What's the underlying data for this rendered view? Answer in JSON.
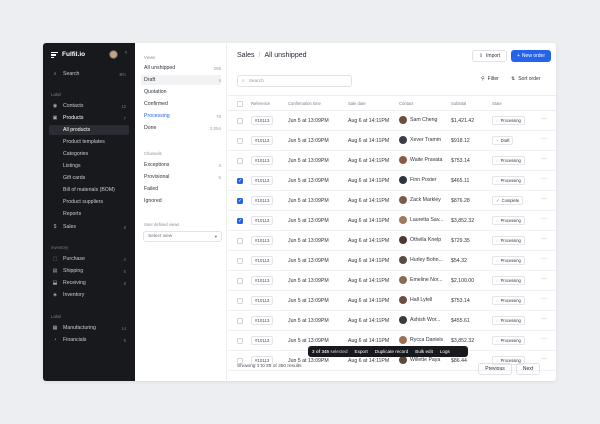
{
  "brand": {
    "name": "Fulfil.io"
  },
  "sidebar": {
    "search": {
      "label": "Search",
      "shortcut": "⌘K"
    },
    "label_section": "Label",
    "main_items": [
      {
        "label": "Contacts",
        "icon": "contacts-icon",
        "count": "12"
      },
      {
        "label": "Products",
        "icon": "products-icon",
        "count": "7"
      }
    ],
    "product_sub": [
      "All products",
      "Product templates",
      "Categories",
      "Listings",
      "Gift cards",
      "Bill of materials (BOM)",
      "Product suppliers",
      "Reports"
    ],
    "sales": {
      "label": "Sales",
      "count": "8"
    },
    "inventory_section": "Inventory",
    "inventory_items": [
      {
        "label": "Purchase",
        "count": "4"
      },
      {
        "label": "Shipping",
        "count": "5"
      },
      {
        "label": "Receiving",
        "count": "8"
      },
      {
        "label": "Inventory",
        "count": ""
      }
    ],
    "label_section2": "Label",
    "bottom_items": [
      {
        "label": "Manufacturing",
        "count": "14"
      },
      {
        "label": "Financials",
        "count": "5"
      }
    ]
  },
  "views": {
    "views_title": "Views",
    "items": [
      {
        "label": "All unshipped",
        "count": "258"
      },
      {
        "label": "Draft",
        "count": "4"
      },
      {
        "label": "Quotation",
        "count": ""
      },
      {
        "label": "Confirmed",
        "count": ""
      },
      {
        "label": "Processing",
        "count": "78"
      },
      {
        "label": "Done",
        "count": "2,054"
      }
    ],
    "channels_title": "Channels",
    "channels": [
      {
        "label": "Exceptions",
        "count": "3"
      },
      {
        "label": "Provisional",
        "count": "5"
      },
      {
        "label": "Failed",
        "count": ""
      },
      {
        "label": "Ignored",
        "count": ""
      }
    ],
    "user_defined_title": "User defined views",
    "select_view": "Select view"
  },
  "main": {
    "breadcrumb_root": "Sales",
    "breadcrumb_current": "All unshipped",
    "import_label": "Import",
    "new_order_label": "New order",
    "search_placeholder": "Search",
    "filter_label": "Filter",
    "sort_label": "Sort order",
    "columns": [
      "Reference",
      "Confirmation time",
      "Sale date",
      "Contact",
      "Subtotal",
      "State"
    ],
    "rows": [
      {
        "ref": "#10113",
        "conf": "Jun 5 at 13:09PM",
        "date": "Aug 6 at 14:11PM",
        "contact": "Sam Cheng",
        "sub": "$1,421.42",
        "state": "Processing",
        "checked": false,
        "color": "#6b4f3a"
      },
      {
        "ref": "#10113",
        "conf": "Jun 5 at 13:09PM",
        "date": "Aug 6 at 14:11PM",
        "contact": "Xever Tramm",
        "sub": "$918.12",
        "state": "Draft",
        "checked": false,
        "color": "#3a3f47"
      },
      {
        "ref": "#10113",
        "conf": "Jun 5 at 13:09PM",
        "date": "Aug 6 at 14:11PM",
        "contact": "Waite Pravata",
        "sub": "$753.14",
        "state": "Processing",
        "checked": false,
        "color": "#8a5a44"
      },
      {
        "ref": "#10113",
        "conf": "Jun 5 at 13:09PM",
        "date": "Aug 6 at 14:11PM",
        "contact": "Finn Poster",
        "sub": "$465.11",
        "state": "Processing",
        "checked": true,
        "color": "#2f3540"
      },
      {
        "ref": "#10113",
        "conf": "Jun 5 at 13:09PM",
        "date": "Aug 6 at 14:11PM",
        "contact": "Zack Markley",
        "sub": "$876.28",
        "state": "Complete",
        "checked": true,
        "color": "#7a5c48"
      },
      {
        "ref": "#10113",
        "conf": "Jun 5 at 13:09PM",
        "date": "Aug 6 at 14:11PM",
        "contact": "Lauretta Sav...",
        "sub": "$3,852.32",
        "state": "Processing",
        "checked": true,
        "color": "#a0785c"
      },
      {
        "ref": "#10113",
        "conf": "Jun 5 at 13:09PM",
        "date": "Aug 6 at 14:11PM",
        "contact": "Othella Knelp",
        "sub": "$729.35",
        "state": "Processing",
        "checked": false,
        "color": "#4a3a33"
      },
      {
        "ref": "#10113",
        "conf": "Jun 5 at 13:09PM",
        "date": "Aug 6 at 14:11PM",
        "contact": "Hurley Bohn...",
        "sub": "$54.32",
        "state": "Processing",
        "checked": false,
        "color": "#5a4a40"
      },
      {
        "ref": "#10113",
        "conf": "Jun 5 at 13:09PM",
        "date": "Aug 6 at 14:11PM",
        "contact": "Emeline Nor...",
        "sub": "$2,100.00",
        "state": "Processing",
        "checked": false,
        "color": "#8a6a55"
      },
      {
        "ref": "#10113",
        "conf": "Jun 5 at 13:09PM",
        "date": "Aug 6 at 14:11PM",
        "contact": "Hall Lytell",
        "sub": "$753.14",
        "state": "Processing",
        "checked": false,
        "color": "#6e4e3e"
      },
      {
        "ref": "#10113",
        "conf": "Jun 5 at 13:09PM",
        "date": "Aug 6 at 14:11PM",
        "contact": "Ashish Wor...",
        "sub": "$455.61",
        "state": "Processing",
        "checked": false,
        "color": "#3e3a38"
      },
      {
        "ref": "#10113",
        "conf": "Jun 5 at 13:09PM",
        "date": "Aug 6 at 14:11PM",
        "contact": "Rycca Daniels",
        "sub": "$3,852.32",
        "state": "Processing",
        "checked": false,
        "color": "#9a7056"
      },
      {
        "ref": "#10113",
        "conf": "Jun 5 at 13:09PM",
        "date": "Aug 6 at 14:11PM",
        "contact": "Willette Paya",
        "sub": "$86.44",
        "state": "Processing",
        "checked": false,
        "color": "#5e4838"
      }
    ],
    "bulk": {
      "selected_bold": "3 of 345",
      "selected_rest": "selected",
      "export": "Export",
      "duplicate": "Duplicate record",
      "bulk_edit": "Bulk edit",
      "logs": "Logs"
    },
    "footer_text": "Showing 1 to 25 of 350 results",
    "prev_label": "Previous",
    "next_label": "Next"
  },
  "colors": {
    "accent": "#2563eb",
    "sidebar_bg": "#17191d",
    "page_bg": "#eceef1"
  }
}
